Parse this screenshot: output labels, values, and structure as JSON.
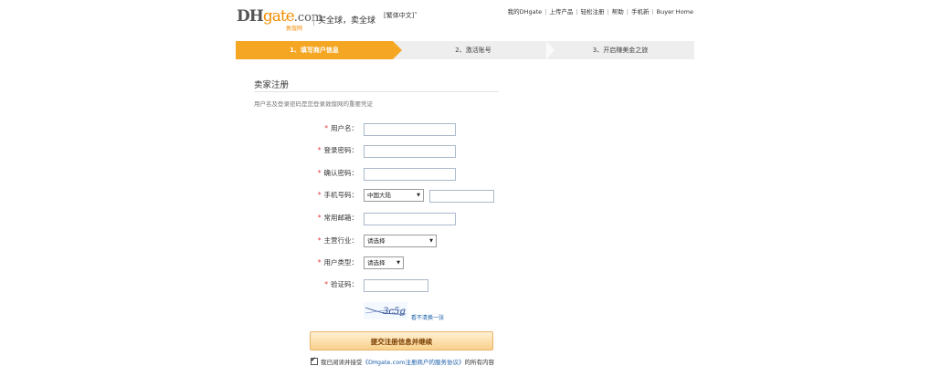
{
  "header": {
    "logo_dh": "DH",
    "logo_gate": "gate",
    "logo_com": ".com",
    "logo_sub": "敦煌网",
    "slogan": "买全球，卖全球",
    "language": "[繁体中文]",
    "links": [
      "我的DHgate",
      "上传产品",
      "轻松注册",
      "帮助",
      "手机新",
      "Buyer Home"
    ]
  },
  "steps": [
    {
      "label": "1、填写商户信息",
      "active": true
    },
    {
      "label": "2、激活账号",
      "active": false
    },
    {
      "label": "3、开启赚美金之旅",
      "active": false
    }
  ],
  "form": {
    "title": "卖家注册",
    "description": "用户名及登录密码是您登录敦煌网的重要凭证",
    "fields": {
      "username": {
        "label": "用户名：",
        "value": ""
      },
      "password": {
        "label": "登录密码：",
        "value": ""
      },
      "confirm_password": {
        "label": "确认密码：",
        "value": ""
      },
      "phone": {
        "label": "手机号码：",
        "region": "中国大陆",
        "value": ""
      },
      "email": {
        "label": "常用邮箱：",
        "value": ""
      },
      "industry": {
        "label": "主营行业：",
        "selected": "请选择"
      },
      "user_type": {
        "label": "用户类型：",
        "selected": "请选择"
      },
      "captcha": {
        "label": "验证码：",
        "value": "",
        "image_text": "3c5g",
        "refresh_link": "看不清换一张"
      }
    },
    "required_mark": "*",
    "submit_label": "提交注册信息并继续",
    "agreement_prefix": "我已阅读并接受",
    "agreement_link": "《DHgate.com注册商户的服务协议》",
    "agreement_suffix": "的所有内容",
    "agreement_checked": true
  },
  "colors": {
    "step_active": "#f5a623",
    "required": "#e4393c",
    "link": "#1a5ea8"
  }
}
